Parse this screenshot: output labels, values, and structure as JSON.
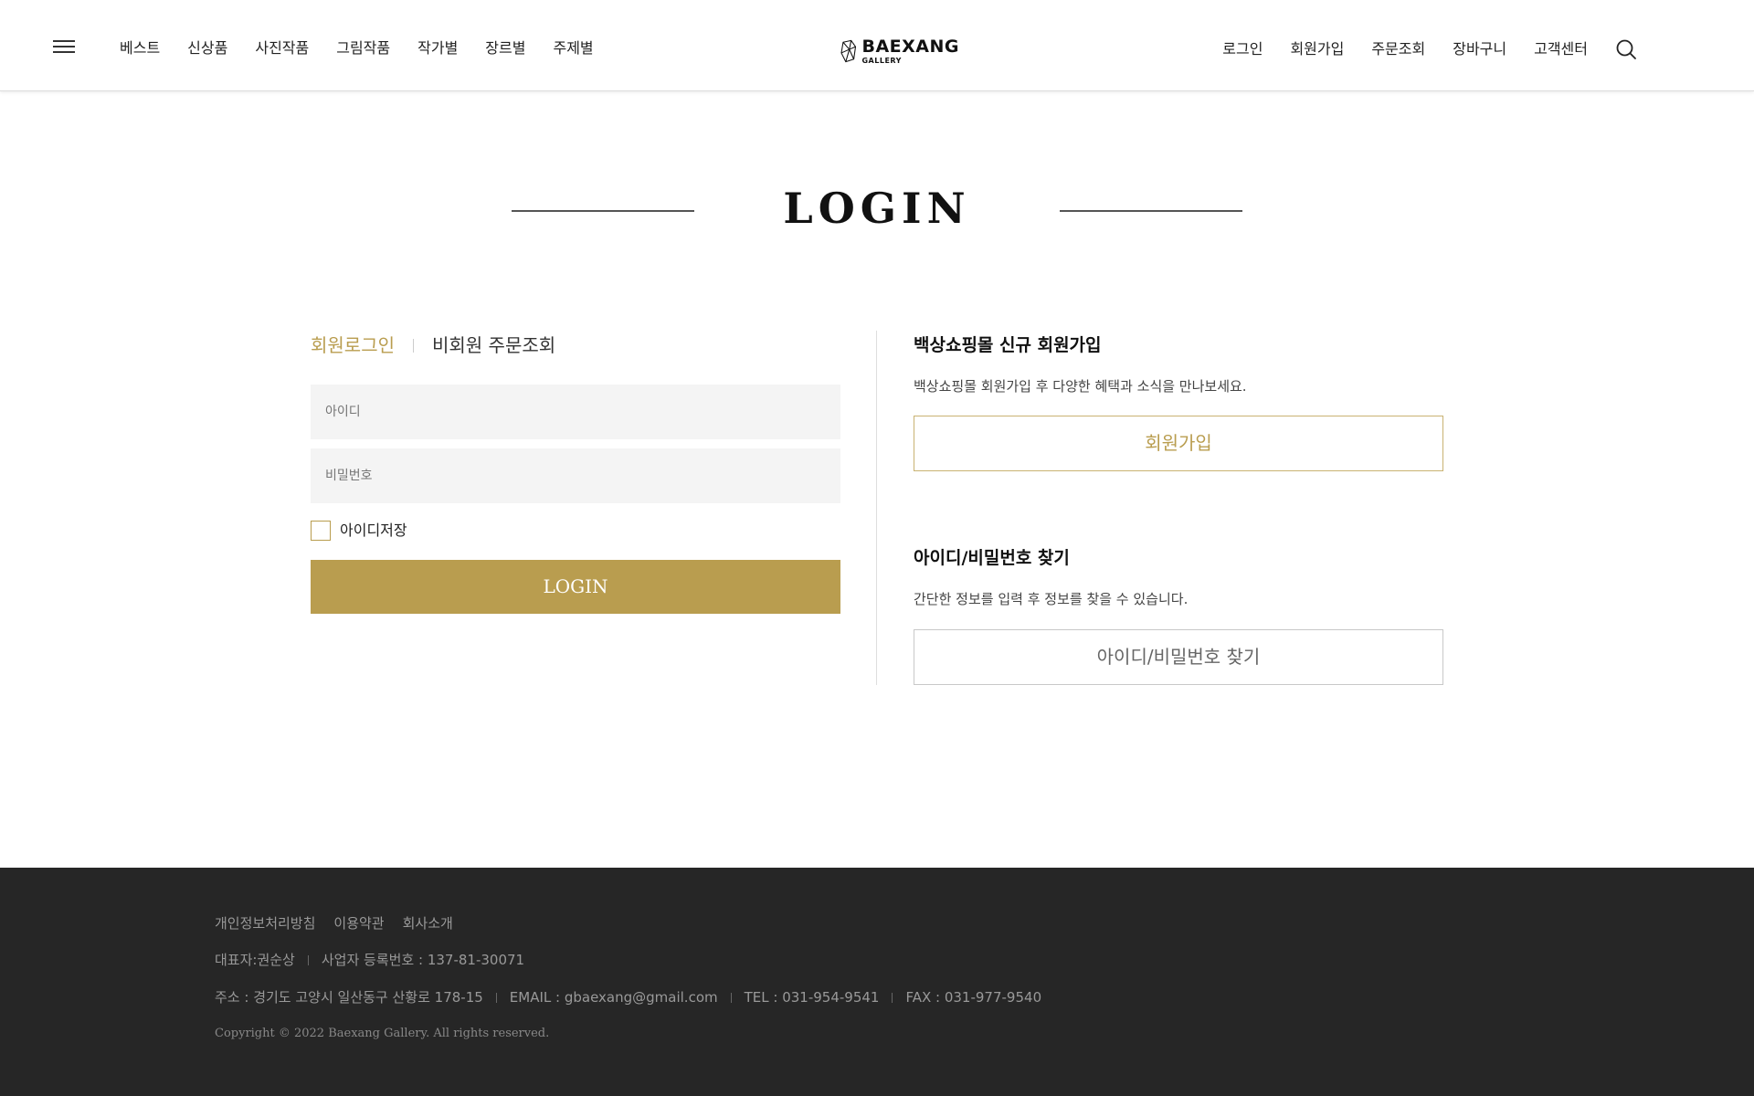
{
  "header": {
    "menu_icon": "hamburger-menu-icon",
    "nav_left": [
      "베스트",
      "신상품",
      "사진작품",
      "그림작품",
      "작가별",
      "장르별",
      "주제별"
    ],
    "logo": {
      "main": "BAEXANG",
      "sub": "GALLERY"
    },
    "nav_right": [
      "로그인",
      "회원가입",
      "주문조회",
      "장바구니",
      "고객센터"
    ],
    "search_icon": "search-icon"
  },
  "page": {
    "title": "LOGIN"
  },
  "login": {
    "tab_member": "회원로그인",
    "tab_guest": "비회원 주문조회",
    "id_placeholder": "아이디",
    "pw_placeholder": "비밀번호",
    "save_id_label": "아이디저장",
    "save_id_checked": false,
    "login_button": "LOGIN"
  },
  "signup": {
    "heading": "백상쇼핑몰 신규 회원가입",
    "desc": "백상쇼핑몰 회원가입 후 다양한 혜택과 소식을 만나보세요.",
    "button": "회원가입"
  },
  "find": {
    "heading": "아이디/비밀번호 찾기",
    "desc": "간단한 정보를 입력 후 정보를 찾을 수 있습니다.",
    "button": "아이디/비밀번호 찾기"
  },
  "footer": {
    "links": [
      "개인정보처리방침",
      "이용약관",
      "회사소개"
    ],
    "ceo": "대표자:권순상",
    "biz_no": "사업자 등록번호 : 137-81-30071",
    "address": "주소 : 경기도 고양시 일산동구 산황로 178-15",
    "email": "EMAIL : gbaexang@gmail.com",
    "tel": "TEL : 031-954-9541",
    "fax": "FAX : 031-977-9540",
    "copyright": "Copyright © 2022 Baexang Gallery. All rights reserved."
  },
  "colors": {
    "accent": "#b99d4f",
    "footer_bg": "#262626"
  }
}
